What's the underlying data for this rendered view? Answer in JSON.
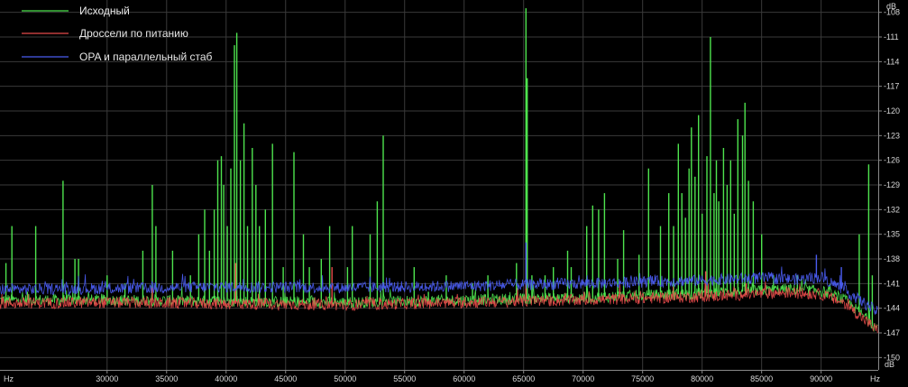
{
  "chart_data": {
    "type": "line",
    "background": "#000000",
    "grid": true,
    "grid_color": "#3a3a3a",
    "x_unit": "Hz",
    "y_unit": "dB",
    "xlim": [
      21000,
      94800
    ],
    "ylim": [
      -151.5,
      -106.5
    ],
    "x_ticks": [
      "30000",
      "35000",
      "40000",
      "45000",
      "50000",
      "55000",
      "60000",
      "65000",
      "70000",
      "75000",
      "80000",
      "85000",
      "90000"
    ],
    "x_tick_values": [
      30000,
      35000,
      40000,
      45000,
      50000,
      55000,
      60000,
      65000,
      70000,
      75000,
      80000,
      85000,
      90000
    ],
    "y_ticks": [
      "-108",
      "-111",
      "-114",
      "-117",
      "-120",
      "-123",
      "-126",
      "-129",
      "-132",
      "-135",
      "-138",
      "-141",
      "-144",
      "-147",
      "-150"
    ],
    "y_tick_values": [
      -108,
      -111,
      -114,
      -117,
      -120,
      -123,
      -126,
      -129,
      -132,
      -135,
      -138,
      -141,
      -144,
      -147,
      -150
    ],
    "legend_placement": "top-left",
    "series": [
      {
        "name": "Исходный",
        "color": "#4ee44e",
        "noise_floor": [
          [
            21000,
            -143.0
          ],
          [
            30000,
            -143.0
          ],
          [
            50000,
            -143.3
          ],
          [
            60000,
            -143.0
          ],
          [
            70000,
            -142.7
          ],
          [
            80000,
            -142.2
          ],
          [
            87000,
            -141.7
          ],
          [
            90000,
            -141.9
          ],
          [
            92000,
            -143.0
          ],
          [
            94800,
            -146.5
          ]
        ],
        "peaks": [
          [
            21500,
            -138.5
          ],
          [
            22000,
            -134
          ],
          [
            23300,
            -142
          ],
          [
            24000,
            -134
          ],
          [
            26300,
            -128.5
          ],
          [
            27300,
            -138
          ],
          [
            27600,
            -138
          ],
          [
            30000,
            -140
          ],
          [
            31500,
            -141
          ],
          [
            33000,
            -137
          ],
          [
            33800,
            -129
          ],
          [
            34100,
            -134
          ],
          [
            35500,
            -137
          ],
          [
            37000,
            -140
          ],
          [
            37700,
            -135
          ],
          [
            38200,
            -132
          ],
          [
            38600,
            -137
          ],
          [
            39000,
            -132
          ],
          [
            39300,
            -126
          ],
          [
            39600,
            -125.5
          ],
          [
            39800,
            -129
          ],
          [
            40100,
            -134
          ],
          [
            40400,
            -127
          ],
          [
            40700,
            -112
          ],
          [
            40900,
            -110.5
          ],
          [
            41200,
            -126
          ],
          [
            41500,
            -121.5
          ],
          [
            41800,
            -134
          ],
          [
            42200,
            -124.5
          ],
          [
            42500,
            -129
          ],
          [
            42800,
            -134
          ],
          [
            43300,
            -132
          ],
          [
            43900,
            -124
          ],
          [
            44800,
            -139
          ],
          [
            45700,
            -125
          ],
          [
            46500,
            -135
          ],
          [
            47000,
            -139
          ],
          [
            48000,
            -138
          ],
          [
            48700,
            -134
          ],
          [
            50200,
            -139
          ],
          [
            50600,
            -134
          ],
          [
            52100,
            -135
          ],
          [
            52700,
            -131
          ],
          [
            53200,
            -123
          ],
          [
            55800,
            -139
          ],
          [
            57000,
            -142
          ],
          [
            58500,
            -140
          ],
          [
            60700,
            -141
          ],
          [
            62000,
            -140
          ],
          [
            64400,
            -138.5
          ],
          [
            65200,
            -107.5
          ],
          [
            65300,
            -116
          ],
          [
            65700,
            -140
          ],
          [
            66800,
            -140
          ],
          [
            67500,
            -139
          ],
          [
            68700,
            -137
          ],
          [
            69000,
            -139
          ],
          [
            70300,
            -134
          ],
          [
            70800,
            -131.5
          ],
          [
            71300,
            -132
          ],
          [
            71800,
            -130
          ],
          [
            72900,
            -138
          ],
          [
            73400,
            -134.5
          ],
          [
            74700,
            -137.5
          ],
          [
            75500,
            -127
          ],
          [
            76500,
            -134
          ],
          [
            77200,
            -130
          ],
          [
            77600,
            -134
          ],
          [
            78000,
            -124
          ],
          [
            78300,
            -130
          ],
          [
            78600,
            -133
          ],
          [
            78900,
            -127
          ],
          [
            79100,
            -122
          ],
          [
            79400,
            -128
          ],
          [
            79700,
            -120.5
          ],
          [
            80000,
            -132.5
          ],
          [
            80400,
            -125.5
          ],
          [
            80700,
            -111
          ],
          [
            81000,
            -130
          ],
          [
            81200,
            -126
          ],
          [
            81400,
            -131
          ],
          [
            81800,
            -124.5
          ],
          [
            82100,
            -129
          ],
          [
            82400,
            -126
          ],
          [
            82700,
            -132.5
          ],
          [
            83000,
            -121
          ],
          [
            83400,
            -123
          ],
          [
            83600,
            -119
          ],
          [
            83900,
            -128.5
          ],
          [
            84300,
            -131
          ],
          [
            85000,
            -135
          ],
          [
            86000,
            -140
          ],
          [
            88000,
            -140
          ],
          [
            93200,
            -135
          ],
          [
            94000,
            -126.5
          ],
          [
            94300,
            -140
          ]
        ]
      },
      {
        "name": "Дроссели по питанию",
        "color": "#e64a4a",
        "noise_floor": [
          [
            21000,
            -143.4
          ],
          [
            30000,
            -143.3
          ],
          [
            50000,
            -143.6
          ],
          [
            60000,
            -143.3
          ],
          [
            70000,
            -143.0
          ],
          [
            80000,
            -142.6
          ],
          [
            87000,
            -142.1
          ],
          [
            90000,
            -142.3
          ],
          [
            92000,
            -143.4
          ],
          [
            94800,
            -146.8
          ]
        ],
        "peaks": [
          [
            33800,
            -141.5
          ],
          [
            40800,
            -138.5
          ],
          [
            48900,
            -139
          ],
          [
            65200,
            -136.5
          ],
          [
            80300,
            -139.5
          ],
          [
            83700,
            -141
          ]
        ]
      },
      {
        "name": "OPA и параллельный стаб",
        "color": "#4a5cf0",
        "noise_floor": [
          [
            21000,
            -141.7
          ],
          [
            30000,
            -141.6
          ],
          [
            40000,
            -141.4
          ],
          [
            50000,
            -141.5
          ],
          [
            60000,
            -141.3
          ],
          [
            70000,
            -141.0
          ],
          [
            80000,
            -140.6
          ],
          [
            85000,
            -140.3
          ],
          [
            88000,
            -140.5
          ],
          [
            90000,
            -140.2
          ],
          [
            91500,
            -141.4
          ],
          [
            93000,
            -142.8
          ],
          [
            94800,
            -144.5
          ]
        ],
        "peaks": [
          [
            65200,
            -136
          ],
          [
            89600,
            -137.5
          ],
          [
            91700,
            -139
          ]
        ]
      }
    ]
  }
}
